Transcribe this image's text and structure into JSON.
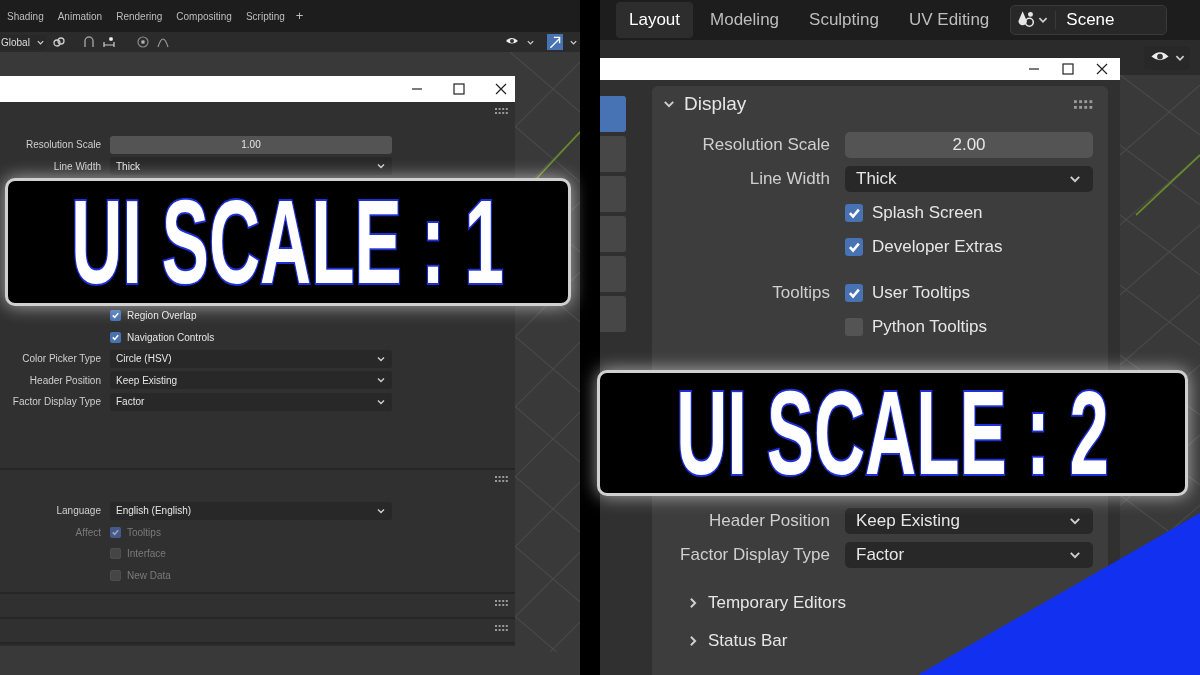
{
  "left": {
    "workspace_tabs": [
      {
        "label": "Shading",
        "selected": false
      },
      {
        "label": "Animation",
        "selected": false
      },
      {
        "label": "Rendering",
        "selected": false
      },
      {
        "label": "Compositing",
        "selected": false
      },
      {
        "label": "Scripting",
        "selected": false
      }
    ],
    "add_tab": "+",
    "toolbar": {
      "orientation": "Global"
    },
    "sections": [
      {
        "rows": [
          {
            "kind": "number",
            "label": "Resolution Scale",
            "value": "1.00"
          },
          {
            "kind": "dropdown",
            "label": "Line Width",
            "value": "Thick"
          },
          {
            "kind": "hidden"
          },
          {
            "kind": "checkbox",
            "text": "Region Overlap",
            "checked": true,
            "disabled": false
          },
          {
            "kind": "checkbox",
            "text": "Navigation Controls",
            "checked": true,
            "disabled": false
          },
          {
            "kind": "dropdown",
            "label": "Color Picker Type",
            "value": "Circle (HSV)"
          },
          {
            "kind": "dropdown",
            "label": "Header Position",
            "value": "Keep Existing"
          },
          {
            "kind": "dropdown",
            "label": "Factor Display Type",
            "value": "Factor"
          }
        ]
      },
      {
        "rows": [
          {
            "kind": "dropdown",
            "label": "Language",
            "value": "English (English)"
          },
          {
            "kind": "checkbox",
            "label": "Affect",
            "text": "Tooltips",
            "checked": true,
            "disabled": true
          },
          {
            "kind": "checkbox",
            "text": "Interface",
            "checked": false,
            "disabled": true
          },
          {
            "kind": "checkbox",
            "text": "New Data",
            "checked": false,
            "disabled": true
          }
        ]
      }
    ],
    "banner": "UI SCALE : 1"
  },
  "right": {
    "workspace_tabs": [
      {
        "label": "Layout",
        "selected": true
      },
      {
        "label": "Modeling",
        "selected": false
      },
      {
        "label": "Sculpting",
        "selected": false
      },
      {
        "label": "UV Editing",
        "selected": false
      }
    ],
    "scene": "Scene",
    "category_tabs": [
      {
        "selected": true
      },
      {
        "selected": false
      },
      {
        "selected": false
      },
      {
        "selected": false
      },
      {
        "selected": false
      },
      {
        "selected": false
      }
    ],
    "panel": {
      "title": "Display",
      "expanded": true,
      "rows": [
        {
          "kind": "number",
          "label": "Resolution Scale",
          "value": "2.00"
        },
        {
          "kind": "dropdown",
          "label": "Line Width",
          "value": "Thick"
        },
        {
          "kind": "checkbox",
          "text": "Splash Screen",
          "checked": true,
          "disabled": false
        },
        {
          "kind": "checkbox",
          "text": "Developer Extras",
          "checked": true,
          "disabled": false
        },
        {
          "kind": "checkbox",
          "label": "Tooltips",
          "text": "User Tooltips",
          "checked": true,
          "disabled": false
        },
        {
          "kind": "checkbox",
          "text": "Python Tooltips",
          "checked": false,
          "disabled": false
        },
        {
          "kind": "hidden"
        },
        {
          "kind": "dropdown",
          "label": "Header Position",
          "value": "Keep Existing"
        },
        {
          "kind": "dropdown",
          "label": "Factor Display Type",
          "value": "Factor"
        }
      ]
    },
    "subpanels": [
      {
        "title": "Temporary Editors",
        "expanded": false
      },
      {
        "title": "Status Bar",
        "expanded": false
      }
    ],
    "banner": "UI SCALE : 2"
  }
}
